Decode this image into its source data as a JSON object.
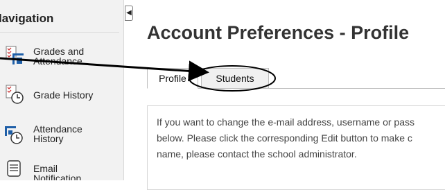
{
  "sidebar": {
    "title": "lavigation",
    "items": [
      {
        "label_lines": [
          "Grades and",
          "Attendance"
        ],
        "icon": "grades-attendance-icon"
      },
      {
        "label_lines": [
          "Grade History"
        ],
        "icon": "grade-history-icon"
      },
      {
        "label_lines": [
          "Attendance",
          "History"
        ],
        "icon": "attendance-history-icon"
      },
      {
        "label_lines": [
          "Email",
          "Notification"
        ],
        "icon": "email-notification-icon"
      }
    ],
    "collapse_glyph": "◀"
  },
  "main": {
    "title": "Account Preferences - Profile",
    "tabs": [
      {
        "label": "Profile"
      },
      {
        "label": "Students"
      }
    ],
    "body_lines": [
      "If you want to change the e-mail address, username or pass",
      "below. Please click the corresponding Edit button to make c",
      "name, please contact the school administrator."
    ]
  },
  "colors": {
    "sidebar_bg": "#f2f2f2",
    "annotation": "#000000"
  }
}
